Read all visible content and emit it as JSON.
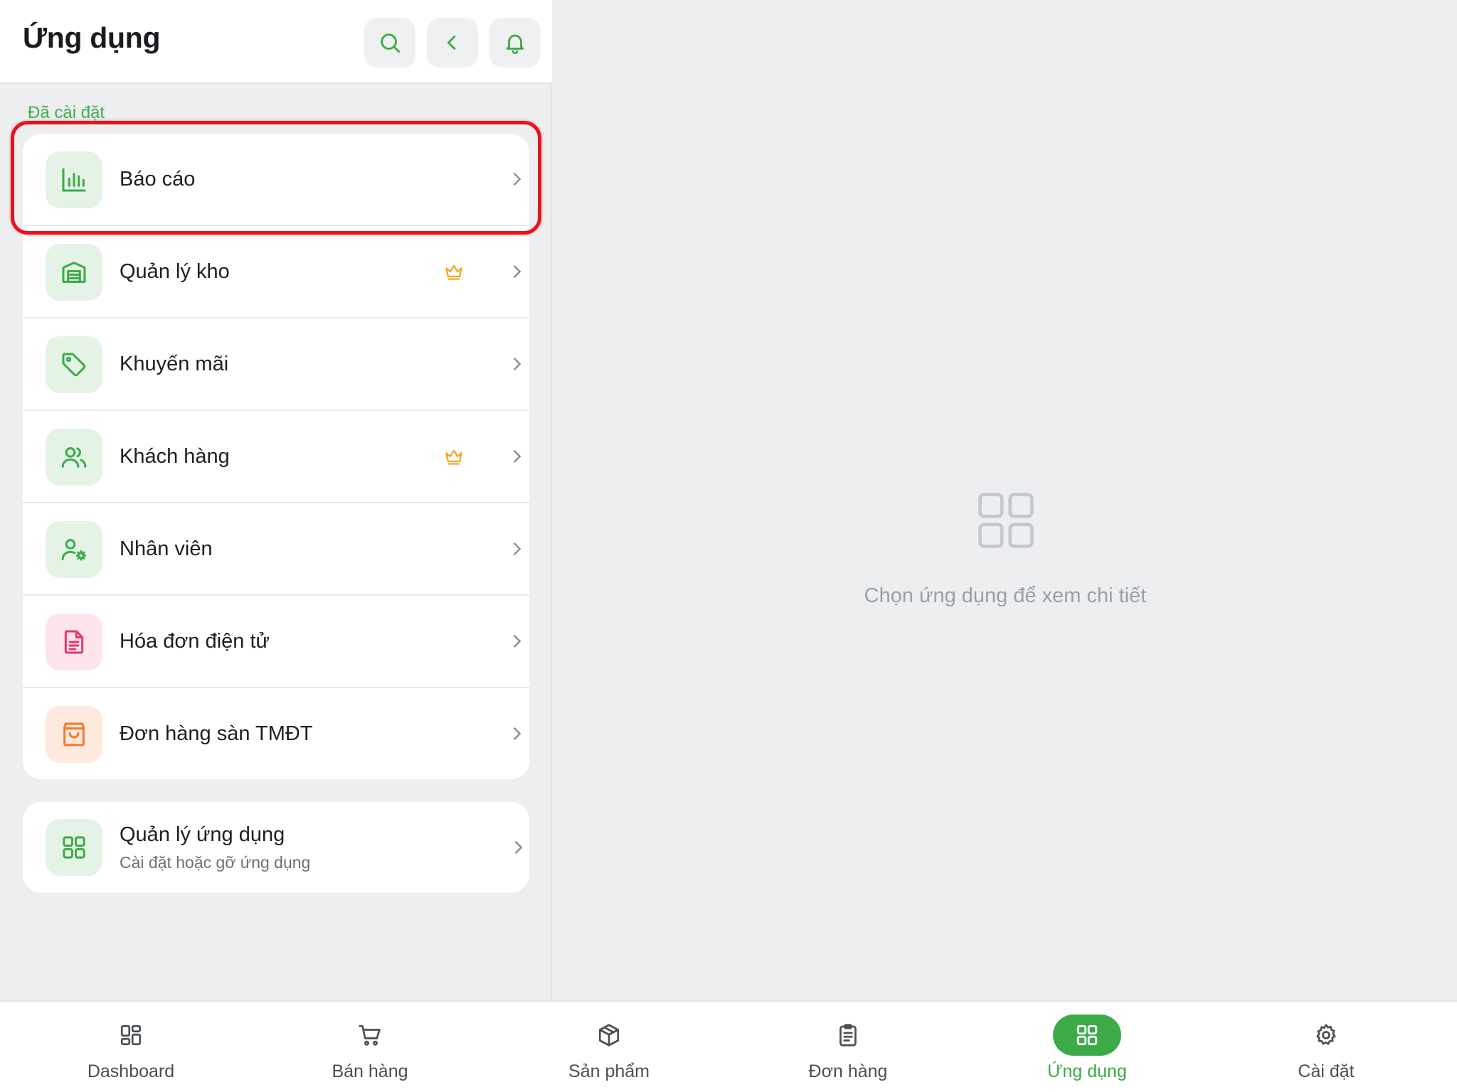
{
  "header": {
    "title": "Ứng dụng",
    "buttons": [
      {
        "icon": "search-icon"
      },
      {
        "icon": "chevron-left-icon"
      },
      {
        "icon": "bell-icon"
      }
    ]
  },
  "installed": {
    "section_label": "Đã cài đặt",
    "items": [
      {
        "label": "Báo cáo",
        "icon": "bar-chart-icon",
        "premium": false,
        "highlighted": true
      },
      {
        "label": "Quản lý kho",
        "icon": "warehouse-icon",
        "premium": true
      },
      {
        "label": "Khuyến mãi",
        "icon": "tag-icon",
        "premium": false
      },
      {
        "label": "Khách hàng",
        "icon": "users-icon",
        "premium": true
      },
      {
        "label": "Nhân viên",
        "icon": "user-cog-icon",
        "premium": false
      },
      {
        "label": "Hóa đơn điện tử",
        "icon": "file-text-icon",
        "premium": false
      },
      {
        "label": "Đơn hàng sàn TMĐT",
        "icon": "shopping-bag-icon",
        "premium": false
      }
    ]
  },
  "manage": {
    "title": "Quản lý ứng dụng",
    "subtitle": "Cài đặt hoặc gỡ ứng dụng",
    "icon": "grid-icon"
  },
  "detail": {
    "empty_text": "Chọn ứng dụng để xem chi tiết",
    "icon": "grid-icon"
  },
  "bottom_nav": {
    "items": [
      {
        "label": "Dashboard",
        "icon": "dashboard-icon",
        "active": false
      },
      {
        "label": "Bán hàng",
        "icon": "cart-icon",
        "active": false
      },
      {
        "label": "Sản phẩm",
        "icon": "box-icon",
        "active": false
      },
      {
        "label": "Đơn hàng",
        "icon": "clipboard-icon",
        "active": false
      },
      {
        "label": "Ứng dụng",
        "icon": "grid-icon",
        "active": true
      },
      {
        "label": "Cài đặt",
        "icon": "gear-icon",
        "active": false
      }
    ]
  },
  "colors": {
    "accent": "#3daa48",
    "premium": "#f5a623",
    "highlight_border": "#e8141c",
    "pink_icon": "#e8376a",
    "orange_icon": "#f07a2a"
  }
}
